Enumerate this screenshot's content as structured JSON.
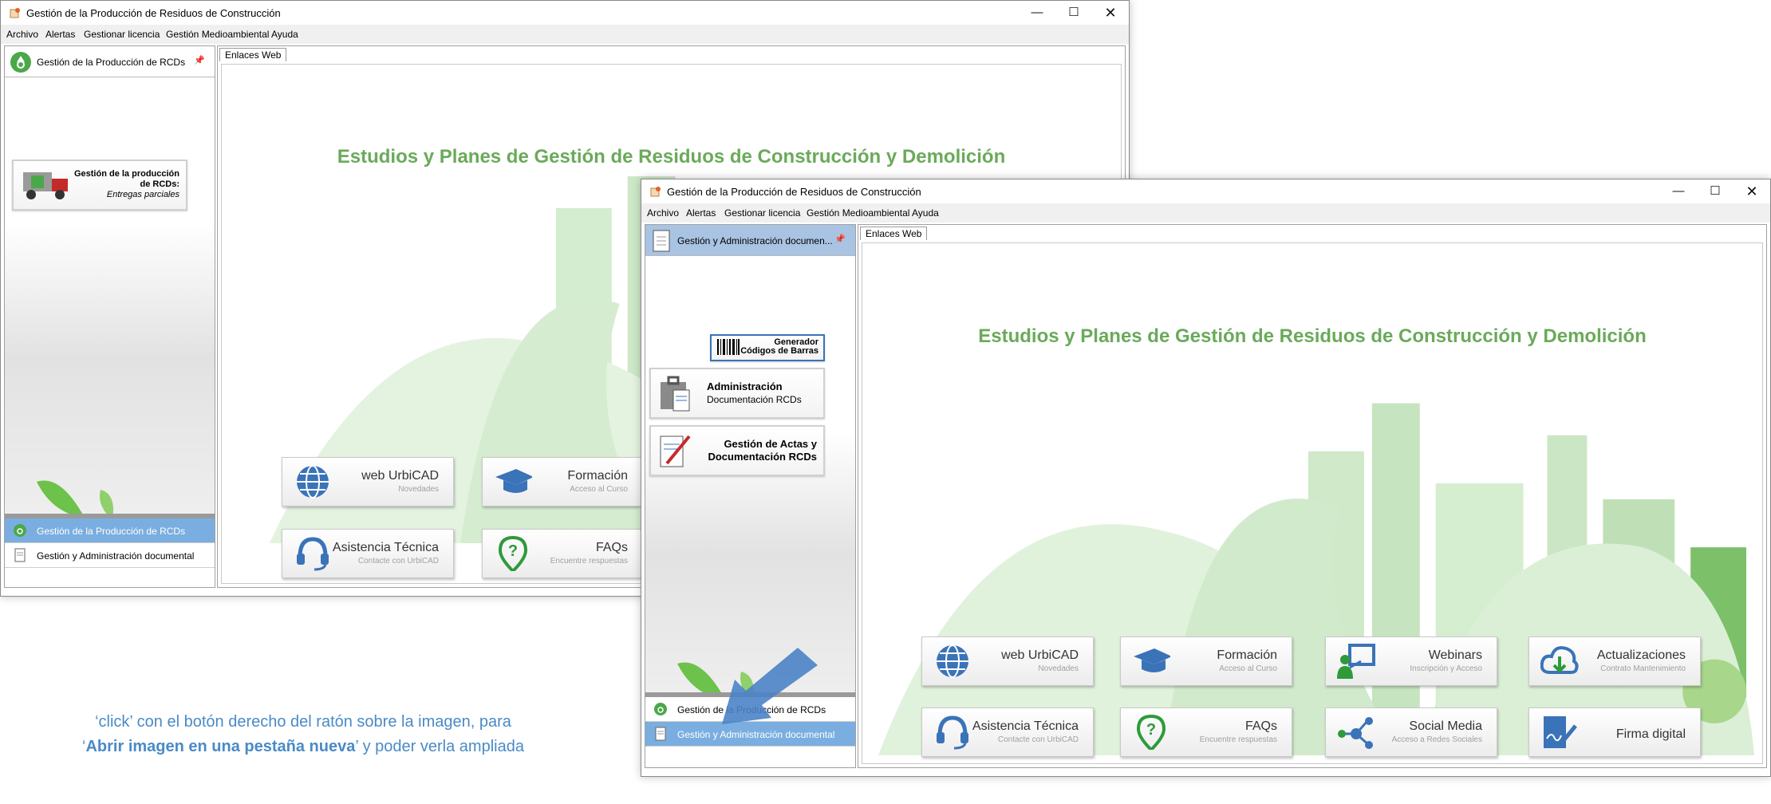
{
  "window": {
    "title": "Gestión de la Producción de Residuos de Construcción",
    "controls": {
      "minimize": "—",
      "maximize": "☐",
      "close": "✕"
    }
  },
  "menu": [
    "Archivo",
    "Alertas",
    "Gestionar licencia",
    "Gestión Medioambiental",
    "Ayuda"
  ],
  "tab_label": "Enlaces Web",
  "heading": "Estudios y Planes de Gestión de Residuos de Construcción y Demolición",
  "back_window": {
    "sidebar_title": "Gestión de la Producción de RCDs",
    "card": {
      "line1": "Gestión de la producción",
      "line2": "de RCDs:",
      "line3": "Entregas parciales"
    },
    "nav": [
      {
        "label": "Gestión de la Producción de RCDs",
        "selected": true
      },
      {
        "label": "Gestión y Administración documental",
        "selected": false
      }
    ]
  },
  "front_window": {
    "sidebar_title": "Gestión y Administración documen...",
    "buttons": {
      "barcode": {
        "line1": "Generador",
        "line2": "Códigos de Barras"
      },
      "admin": {
        "line1": "Administración",
        "line2": "Documentación RCDs"
      },
      "actas": {
        "line1": "Gestión de Actas y",
        "line2": "Documentación RCDs"
      }
    },
    "nav": [
      {
        "label": "Gestión de la Producción de RCDs",
        "selected": false
      },
      {
        "label": "Gestión y Administración documental",
        "selected": true
      }
    ]
  },
  "tiles": [
    {
      "label": "web UrbiCAD",
      "sub": "Novedades",
      "icon": "globe-icon"
    },
    {
      "label": "Formación",
      "sub": "Acceso al Curso",
      "icon": "graduation-cap-icon"
    },
    {
      "label": "Webinars",
      "sub": "Inscripción y Acceso",
      "icon": "presenter-icon"
    },
    {
      "label": "Actualizaciones",
      "sub": "Contrato Mantenimiento",
      "icon": "cloud-download-icon"
    },
    {
      "label": "Asistencia Técnica",
      "sub": "Contacte con UrbiCAD",
      "icon": "headset-icon"
    },
    {
      "label": "FAQs",
      "sub": "Encuentre respuestas",
      "icon": "question-pin-icon"
    },
    {
      "label": "Social Media",
      "sub": "Acceso a Redes Sociales",
      "icon": "network-icon"
    },
    {
      "label": "Firma digital",
      "sub": "",
      "icon": "signature-icon"
    }
  ],
  "caption": {
    "part1": "‘click’ con el botón derecho del ratón sobre la imagen, para",
    "part2_pre": "‘",
    "part2_bold": "Abrir imagen en una pestaña nueva",
    "part2_post": "’ y poder verla ampliada"
  },
  "colors": {
    "heading": "#6aaa5a",
    "selection": "#7aaee0",
    "icon_blue": "#3a73b8",
    "icon_green": "#2e9a3a",
    "caption": "#4a8ac6"
  }
}
